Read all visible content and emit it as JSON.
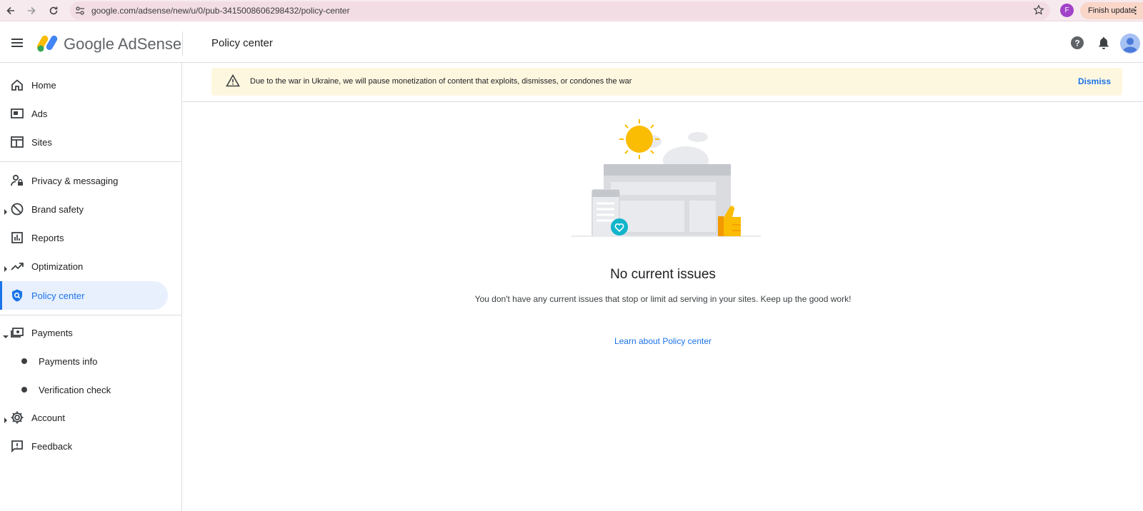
{
  "browser": {
    "url": "google.com/adsense/new/u/0/pub-3415008606298432/policy-center",
    "profile_initial": "F",
    "finish_update_label": "Finish update"
  },
  "header": {
    "product_name": "Google AdSense",
    "page_title": "Policy center"
  },
  "sidebar": {
    "items": [
      {
        "label": "Home",
        "icon": "home-icon"
      },
      {
        "label": "Ads",
        "icon": "ads-icon"
      },
      {
        "label": "Sites",
        "icon": "sites-icon"
      },
      {
        "label": "Privacy & messaging",
        "icon": "privacy-icon"
      },
      {
        "label": "Brand safety",
        "icon": "block-icon"
      },
      {
        "label": "Reports",
        "icon": "reports-icon"
      },
      {
        "label": "Optimization",
        "icon": "trending-icon"
      },
      {
        "label": "Policy center",
        "icon": "policy-shield-icon"
      },
      {
        "label": "Payments",
        "icon": "payments-icon"
      },
      {
        "label": "Account",
        "icon": "gear-icon"
      },
      {
        "label": "Feedback",
        "icon": "feedback-icon"
      }
    ],
    "payments_sub": [
      {
        "label": "Payments info"
      },
      {
        "label": "Verification check"
      }
    ]
  },
  "banner": {
    "text": "Due to the war in Ukraine, we will pause monetization of content that exploits, dismisses, or condones the war",
    "dismiss_label": "Dismiss"
  },
  "main": {
    "title": "No current issues",
    "description": "You don't have any current issues that stop or limit ad serving in your sites. Keep up the good work!",
    "link_label": "Learn about Policy center"
  },
  "colors": {
    "accent": "#1a73e8",
    "banner_bg": "#fef7e0",
    "active_nav_bg": "#e8f0fe"
  }
}
